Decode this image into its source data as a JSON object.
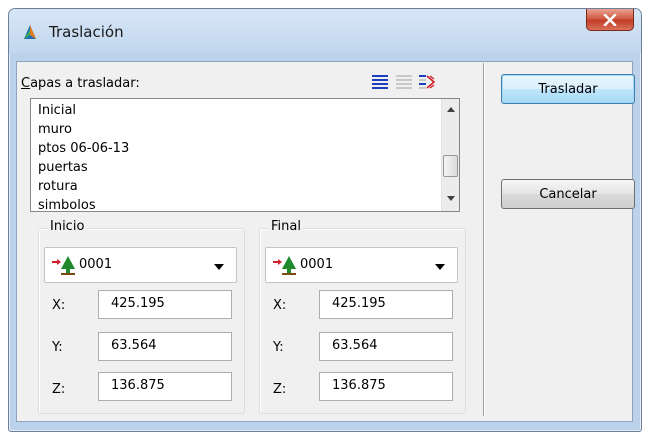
{
  "window": {
    "title": "Traslación",
    "close_label": "x"
  },
  "capas": {
    "label_prefix": "C",
    "label_rest": "apas a trasladar:",
    "items": [
      "Inicial",
      "muro",
      "ptos 06-06-13",
      "puertas",
      "rotura",
      "simbolos"
    ]
  },
  "toolbar": {
    "icons": [
      "select-all-icon",
      "select-none-icon",
      "invert-selection-icon"
    ]
  },
  "inicio": {
    "group_label": "Inicio",
    "point": "0001",
    "x_label": "X:",
    "x_value": "425.195",
    "y_label": "Y:",
    "y_value": "63.564",
    "z_label": "Z:",
    "z_value": "136.875"
  },
  "final": {
    "group_label": "Final",
    "point": "0001",
    "x_label": "X:",
    "x_value": "425.195",
    "y_label": "Y:",
    "y_value": "63.564",
    "z_label": "Z:",
    "z_value": "136.875"
  },
  "buttons": {
    "trasladar": "Trasladar",
    "cancelar": "Cancelar"
  },
  "colors": {
    "frame": "#bcd2ea",
    "close": "#c13a22",
    "face": "#f0f0f0"
  }
}
